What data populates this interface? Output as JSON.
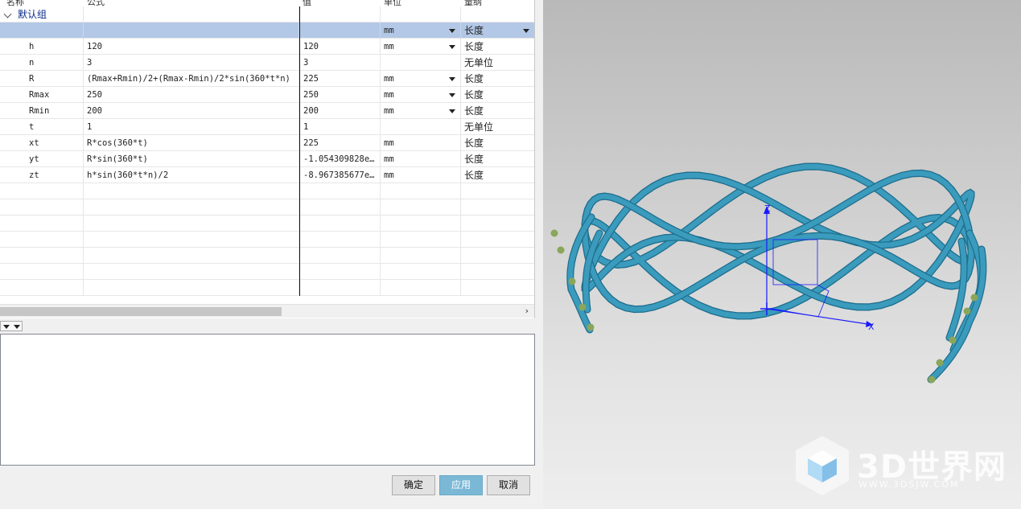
{
  "columns": {
    "name": "名称",
    "formula": "公式",
    "value": "值",
    "unit": "单位",
    "dimension": "量纲"
  },
  "group": {
    "label": "默认组"
  },
  "new_row": {
    "unit": "mm",
    "dimension": "长度"
  },
  "rows": [
    {
      "name": "h",
      "formula": "120",
      "value": "120",
      "unit": "mm",
      "dimension": "长度",
      "dropdown": true
    },
    {
      "name": "n",
      "formula": "3",
      "value": "3",
      "unit": "",
      "dimension": "无单位",
      "dropdown": false
    },
    {
      "name": "R",
      "formula": "(Rmax+Rmin)/2+(Rmax-Rmin)/2*sin(360*t*n)",
      "value": "225",
      "unit": "mm",
      "dimension": "长度",
      "dropdown": true
    },
    {
      "name": "Rmax",
      "formula": "250",
      "value": "250",
      "unit": "mm",
      "dimension": "长度",
      "dropdown": true
    },
    {
      "name": "Rmin",
      "formula": "200",
      "value": "200",
      "unit": "mm",
      "dimension": "长度",
      "dropdown": true
    },
    {
      "name": "t",
      "formula": "1",
      "value": "1",
      "unit": "",
      "dimension": "无单位",
      "dropdown": false
    },
    {
      "name": "xt",
      "formula": "R*cos(360*t)",
      "value": "225",
      "unit": "mm",
      "dimension": "长度",
      "dropdown": false
    },
    {
      "name": "yt",
      "formula": "R*sin(360*t)",
      "value": "-1.054309828e…",
      "unit": "mm",
      "dimension": "长度",
      "dropdown": false
    },
    {
      "name": "zt",
      "formula": "h*sin(360*t*n)/2",
      "value": "-8.967385677e…",
      "unit": "mm",
      "dimension": "长度",
      "dropdown": false
    }
  ],
  "buttons": {
    "ok": "确定",
    "apply": "应用",
    "cancel": "取消"
  },
  "scroll_right": "›",
  "triad": {
    "x": "X",
    "z": "Z"
  },
  "colors": {
    "tube": "#3a9bbd",
    "tube_dark": "#1f6f8e",
    "endcap": "#8aa65a",
    "axis": "#1a1aff",
    "selection": "#b3c8e6",
    "apply": "#7ab8d6"
  },
  "watermark": {
    "title": "3D世界网",
    "url": "WWW.3DSJW.COM"
  }
}
